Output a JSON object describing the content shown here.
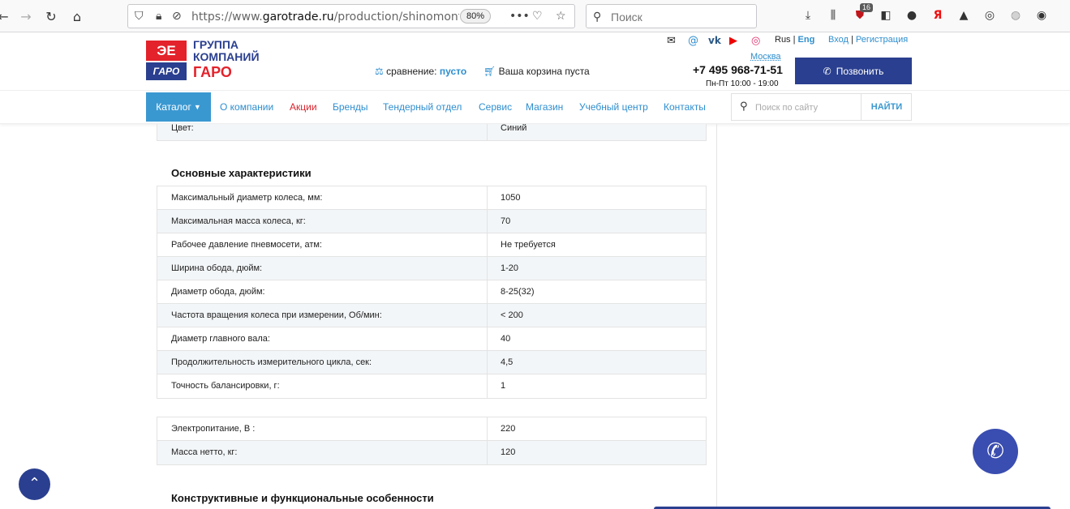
{
  "browser": {
    "url_prefix": "https://www.",
    "url_domain": "garotrade.ru",
    "url_path": "/production/shinomontazh",
    "zoom": "80%",
    "search_placeholder": "Поиск",
    "badge_count": "16"
  },
  "header": {
    "logo_top": "ЭЕ",
    "logo_bottom": "ГАРО",
    "logo_line1": "ГРУППА",
    "logo_line2": "КОМПАНИЙ",
    "logo_line3": "ГАРО",
    "compare_label": "сравнение:",
    "compare_value": "пусто",
    "cart_label": "Ваша корзина пуста",
    "lang_rus": "Rus",
    "lang_sep": "|",
    "lang_eng": "Eng",
    "login": "Вход",
    "auth_sep": "|",
    "register": "Регистрация",
    "city": "Москва",
    "phone": "+7 495 968-71-51",
    "hours": "Пн-Пт 10:00 - 19:00",
    "call_button": "Позвонить"
  },
  "nav": {
    "catalog": "Каталог",
    "items": [
      "О компании",
      "Акции",
      "Бренды",
      "Тендерный отдел",
      "Сервис",
      "Магазин",
      "Учебный центр",
      "Контакты"
    ],
    "search_placeholder": "Поиск по сайту",
    "search_button": "НАЙТИ"
  },
  "specs": {
    "color_row": {
      "key": "Цвет:",
      "value": "Синий"
    },
    "main_title": "Основные характеристики",
    "main_rows": [
      {
        "key": "Максимальный диаметр колеса, мм:",
        "value": "1050"
      },
      {
        "key": "Максимальная масса колеса, кг:",
        "value": "70"
      },
      {
        "key": "Рабочее давление пневмосети, атм:",
        "value": "Не требуется"
      },
      {
        "key": "Ширина обода, дюйм:",
        "value": "1-20"
      },
      {
        "key": "Диаметр обода, дюйм:",
        "value": "8-25(32)"
      },
      {
        "key": "Частота вращения колеса при измерении, Об/мин:",
        "value": "< 200"
      },
      {
        "key": "Диаметр главного вала:",
        "value": "40"
      },
      {
        "key": "Продолжительность измерительного цикла, сек:",
        "value": "4,5"
      },
      {
        "key": "Точность балансировки, г:",
        "value": "1"
      }
    ],
    "power_rows": [
      {
        "key": "Электропитание, В :",
        "value": "220"
      },
      {
        "key": "Масса нетто, кг:",
        "value": "120"
      }
    ],
    "features_title": "Конструктивные и функциональные особенности"
  }
}
